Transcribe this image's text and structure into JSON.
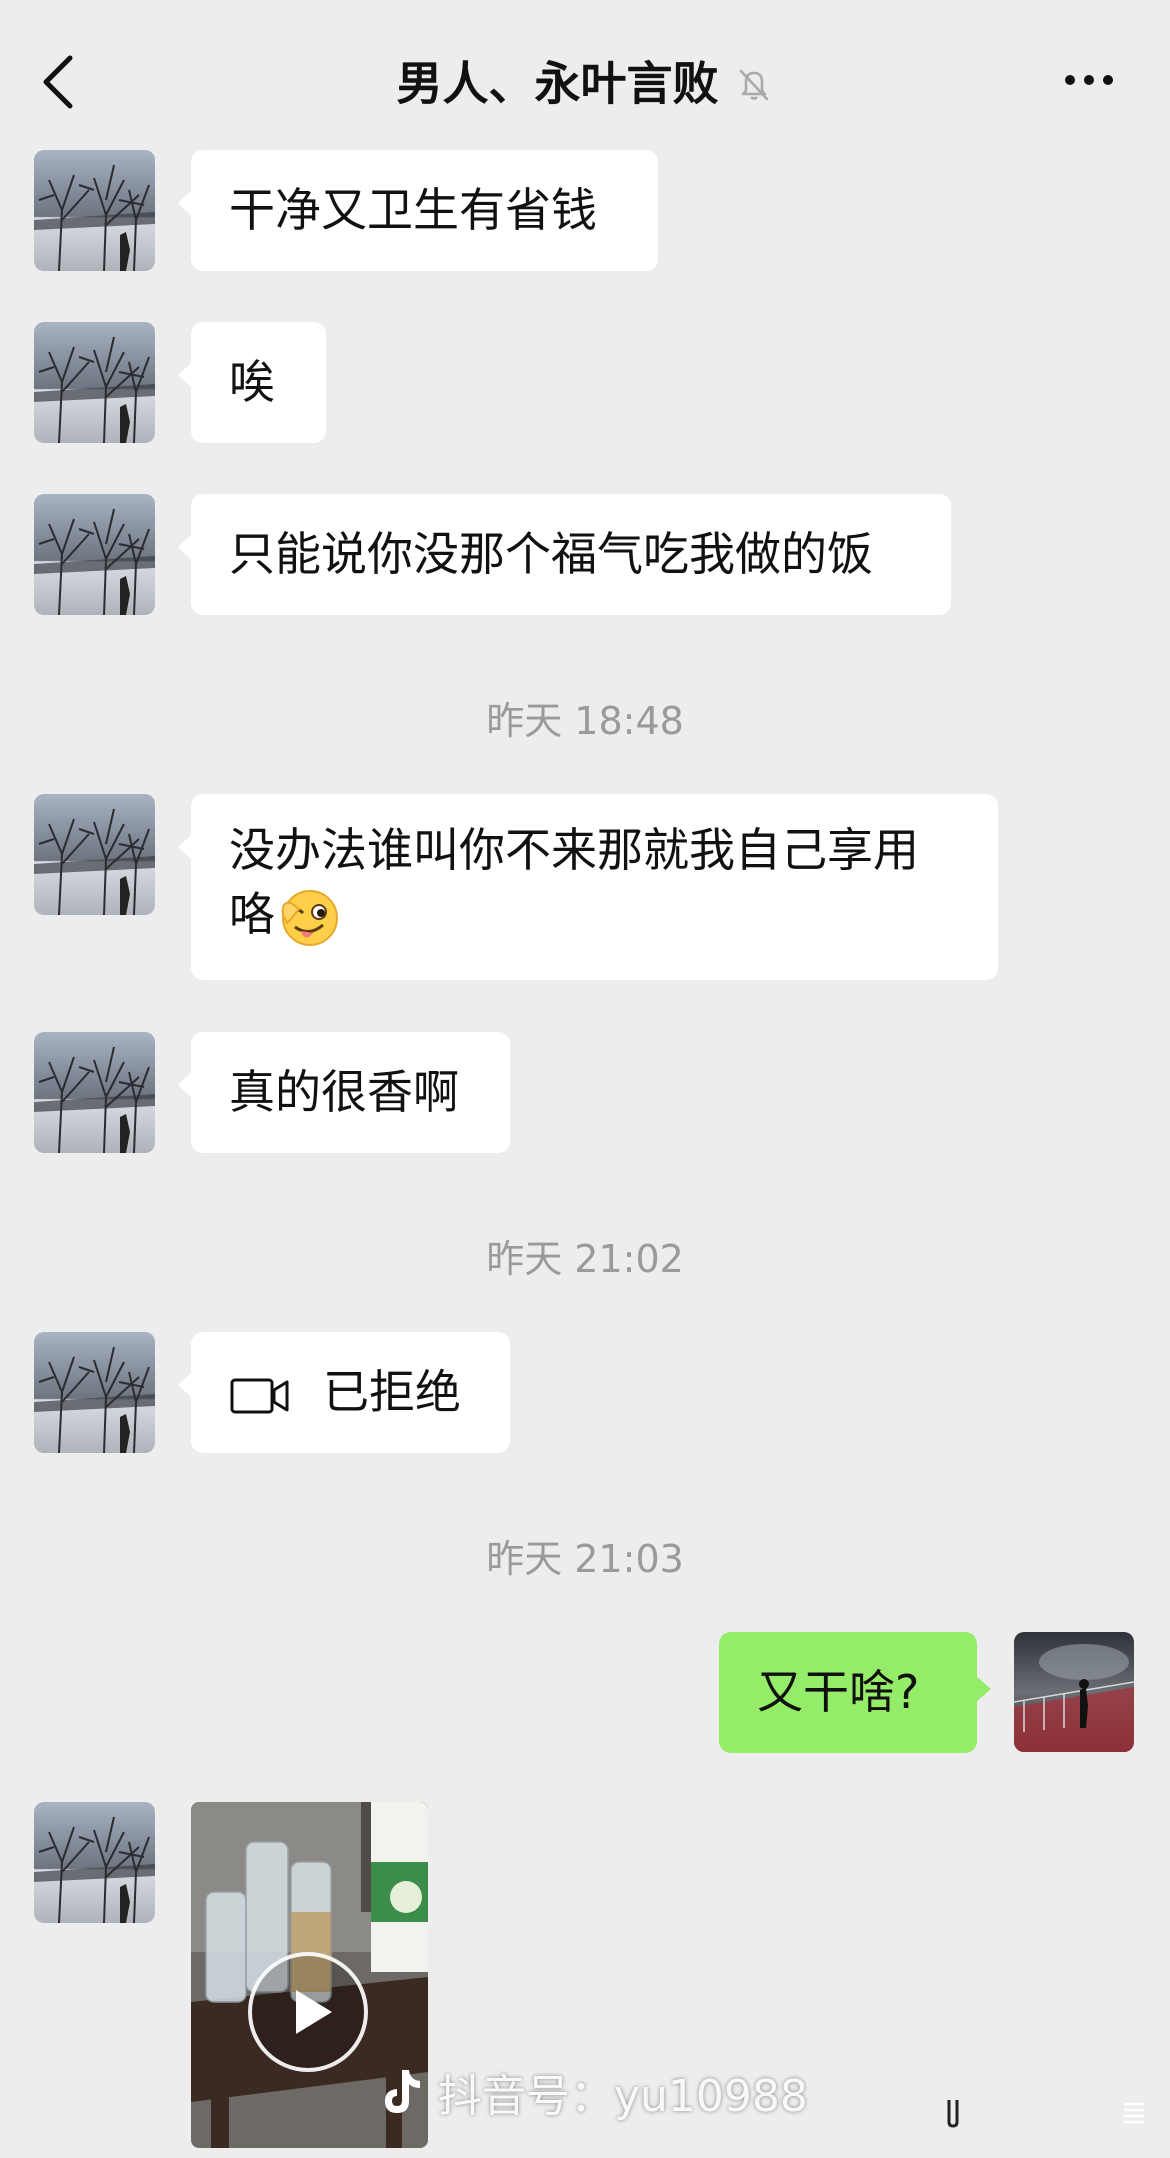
{
  "header": {
    "title": "男人、永叶言败",
    "back_icon": "chevron-left-icon",
    "mute_icon": "bell-off-icon",
    "more_icon": "more-dots-icon"
  },
  "messages": [
    {
      "text": "干净又卫生有省钱"
    },
    {
      "text": "唉"
    },
    {
      "text": "只能说你没那个福气吃我做的饭"
    },
    {
      "line1": "没办法谁叫你不来那就我自己享用",
      "line2": "咯",
      "emoji": "wink-tongue-emoji"
    },
    {
      "text": "真的很香啊"
    },
    {
      "text": "已拒绝",
      "icon": "video-call-icon"
    },
    {
      "text": "又干啥?"
    }
  ],
  "timestamps": [
    "昨天 18:48",
    "昨天 21:02",
    "昨天 21:03"
  ],
  "video": {
    "play_icon": "play-icon"
  },
  "watermark": {
    "text": "抖音号：yu10988",
    "icon": "tiktok-icon"
  },
  "colors": {
    "background": "#ededed",
    "incoming_bubble": "#ffffff",
    "outgoing_bubble": "#95ec69",
    "timestamp": "#9a9a9a"
  }
}
